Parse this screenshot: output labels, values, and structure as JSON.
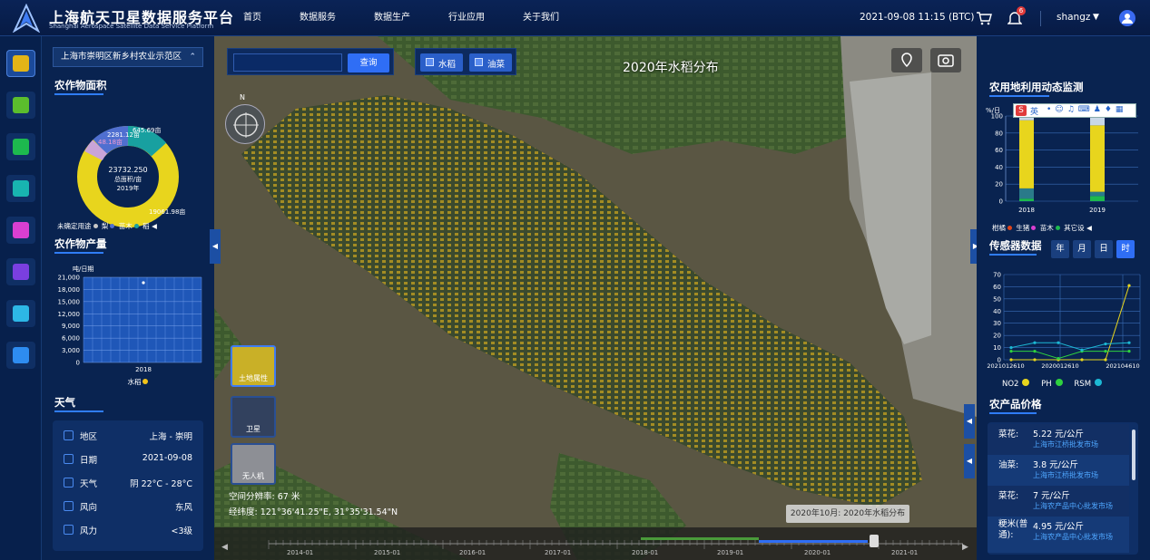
{
  "header": {
    "title_cn": "上海航天卫星数据服务平台",
    "title_en": "Shanghai Aerospace Satellite Data Service Platform",
    "nav": [
      "首页",
      "数据服务",
      "数据生产",
      "行业应用",
      "关于我们"
    ],
    "datetime": "2021-09-08  11:15  (BTC)",
    "notification_count": "6",
    "username": "shangz"
  },
  "left": {
    "location": "上海市崇明区新乡村农业示范区",
    "crop_area": {
      "title": "农作物面积",
      "center_value": "23732.250",
      "center_label": "总面积/亩",
      "center_year": "2019年",
      "labels": [
        "19061.98亩",
        "2281.12亩",
        "645.69亩",
        "48.18亩"
      ],
      "legend": [
        "未确定用途",
        "梨",
        "苗木",
        "稻"
      ]
    },
    "crop_yield": {
      "title": "农作物产量",
      "unit": "吨/日期",
      "yticks": [
        "21,000",
        "18,000",
        "15,000",
        "12,000",
        "9,000",
        "6,000",
        "3,000",
        "0"
      ],
      "xlabel": "2018",
      "legend": "水稻"
    },
    "weather": {
      "title": "天气",
      "rows": [
        {
          "label": "地区",
          "value": "上海 - 崇明"
        },
        {
          "label": "日期",
          "value": "2021-09-08"
        },
        {
          "label": "天气",
          "value": "阴 22°C - 28°C"
        },
        {
          "label": "风向",
          "value": "东风"
        },
        {
          "label": "风力",
          "value": "<3级"
        }
      ]
    }
  },
  "map": {
    "title": "2020年水稻分布",
    "search_placeholder": "",
    "search_button": "查询",
    "layers": [
      "水稻",
      "油菜"
    ],
    "compass_n": "N",
    "thumbs": [
      "土地属性",
      "卫星",
      "无人机"
    ],
    "resolution": "空间分辨率:  67 米",
    "coords": "经纬度:  121°36'41.25\"E, 31°35'31.54\"N",
    "tooltip": "2020年10月: 2020年水稻分布",
    "timeline_years": [
      "2014-01",
      "2015-01",
      "2016-01",
      "2017-01",
      "2018-01",
      "2019-01",
      "2020-01",
      "2021-01"
    ]
  },
  "right": {
    "landuse": {
      "title": "农用地利用动态监测",
      "yunit": "%/日",
      "yticks": [
        "100",
        "80",
        "60",
        "40",
        "20",
        "0"
      ],
      "xlabels": [
        "2018",
        "2019"
      ],
      "legend": [
        "柑橘",
        "生猪",
        "苗木",
        "其它设"
      ]
    },
    "sensor": {
      "title": "传感器数据",
      "tabs": [
        "年",
        "月",
        "日",
        "时"
      ],
      "yticks": [
        "70",
        "60",
        "50",
        "40",
        "30",
        "20",
        "10",
        "0"
      ],
      "xlabels": [
        "2021012610",
        "2020012610",
        "202104610"
      ],
      "legend": [
        "NO2",
        "PH",
        "RSM"
      ]
    },
    "prices": {
      "title": "农产品价格",
      "items": [
        {
          "name": "菜花:",
          "price": "5.22 元/公斤",
          "market": "上海市江桥批发市场"
        },
        {
          "name": "油菜:",
          "price": "3.8 元/公斤",
          "market": "上海市江桥批发市场"
        },
        {
          "name": "菜花:",
          "price": "7 元/公斤",
          "market": "上海农产品中心批发市场"
        },
        {
          "name": "粳米(普通):",
          "price": "4.95 元/公斤",
          "market": "上海农产品中心批发市场"
        }
      ]
    }
  },
  "colors": {
    "accent": "#2f6ef5",
    "rice": "#f2c319",
    "panel": "#092350"
  },
  "chart_data": [
    {
      "type": "pie",
      "title": "农作物面积",
      "categories": [
        "未确定用途",
        "梨",
        "苗木",
        "稻"
      ],
      "values": [
        19061.98,
        2281.12,
        645.69,
        48.18
      ]
    },
    {
      "type": "bar",
      "title": "农用地利用动态监测",
      "categories": [
        "2018",
        "2019"
      ],
      "series": [
        {
          "name": "其它设",
          "values": [
            80,
            78
          ]
        },
        {
          "name": "苗木",
          "values": [
            12,
            5
          ]
        },
        {
          "name": "生猪",
          "values": [
            3,
            6
          ]
        }
      ],
      "ylim": [
        0,
        100
      ]
    },
    {
      "type": "line",
      "title": "传感器数据",
      "x": [
        "2021012610",
        "",
        "2020012610",
        "",
        "",
        "202104610"
      ],
      "series": [
        {
          "name": "NO2",
          "values": [
            0,
            0,
            0,
            0,
            0,
            61
          ]
        },
        {
          "name": "PH",
          "values": [
            7,
            7,
            1,
            7,
            7,
            7
          ]
        },
        {
          "name": "RSM",
          "values": [
            10,
            14,
            14,
            8,
            13,
            14
          ]
        }
      ],
      "ylim": [
        0,
        70
      ]
    }
  ]
}
